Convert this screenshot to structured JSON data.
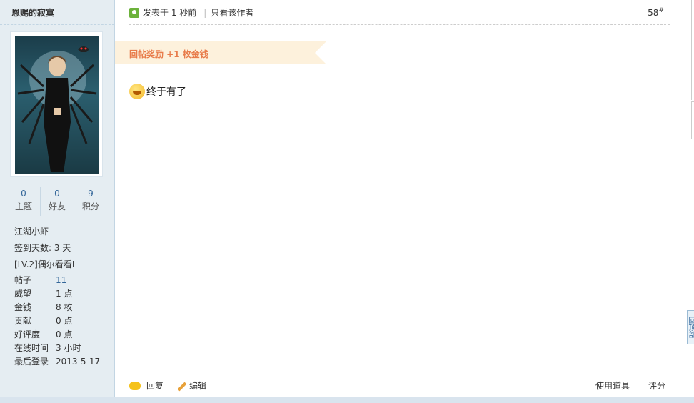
{
  "author": {
    "name": "恩赐的寂寞",
    "stats": [
      {
        "num": "0",
        "label": "主题"
      },
      {
        "num": "0",
        "label": "好友"
      },
      {
        "num": "9",
        "label": "积分"
      }
    ],
    "rank": "江湖小虾",
    "sign_days": "签到天数: 3 天",
    "level": "[LV.2]偶尔看看I",
    "info": [
      {
        "k": "帖子",
        "v": "11"
      },
      {
        "k": "威望",
        "v": "1 点"
      },
      {
        "k": "金钱",
        "v": "8 枚"
      },
      {
        "k": "贡献",
        "v": "0 点"
      },
      {
        "k": "好评度",
        "v": "0 点"
      },
      {
        "k": "在线时间",
        "v": "3 小时"
      },
      {
        "k": "最后登录",
        "v": "2013-5-17"
      }
    ]
  },
  "post": {
    "posted": "发表于 1 秒前",
    "only_author": "只看该作者",
    "floor_num": "58",
    "floor_mark": "#",
    "reward": "回帖奖励 +1 枚金钱",
    "content": "终于有了"
  },
  "actions": {
    "reply": "回复",
    "edit": "编辑",
    "use_item": "使用道具",
    "rate": "评分"
  },
  "back_to_top": "回顶部",
  "colors": {
    "sidebar_bg": "#e5edf2",
    "link": "#336699",
    "reward_text": "#e87c4b",
    "reward_bg": "#fdf1dc"
  }
}
